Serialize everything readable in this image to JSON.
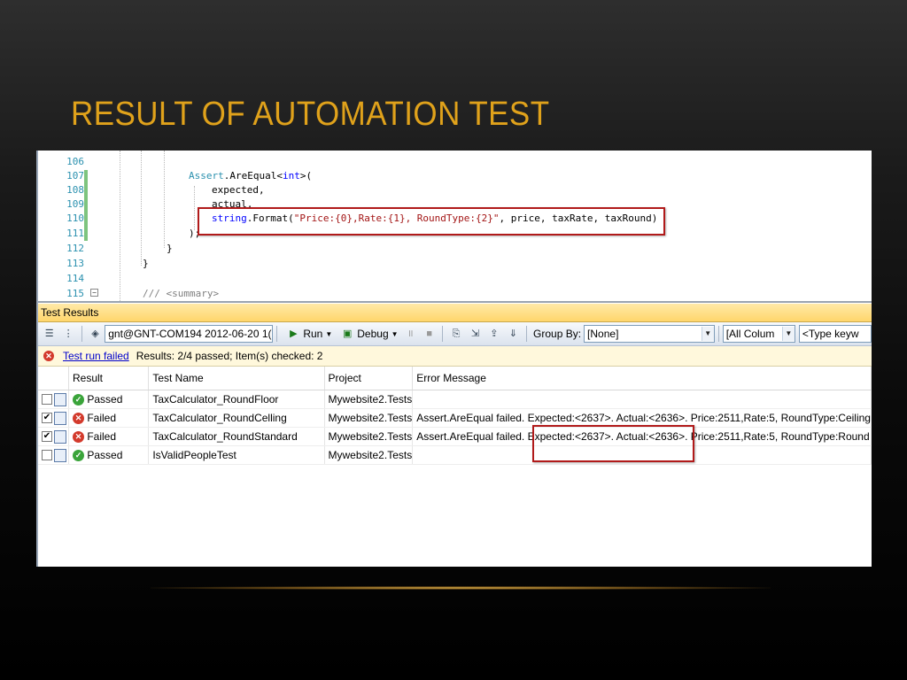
{
  "slide": {
    "title": "RESULT OF AUTOMATION TEST"
  },
  "editor": {
    "line_numbers": [
      "106",
      "107",
      "108",
      "109",
      "110",
      "111",
      "112",
      "113",
      "114",
      "115"
    ],
    "lines": {
      "l107_type": "Assert",
      "l107_rest": ".AreEqual<",
      "l107_kw": "int",
      "l107_end": ">(",
      "l108": "expected,",
      "l109": "actual,",
      "l110_kw": "string",
      "l110_mid": ".Format(",
      "l110_str": "\"Price:{0},Rate:{1}, RoundType:{2}\"",
      "l110_end": ", price, taxRate, taxRound)",
      "l111": ");",
      "l112": "}",
      "l113": "}",
      "l115": "/// <summary>"
    }
  },
  "panel": {
    "title": "Test Results",
    "toolbar": {
      "run_combo": "gnt@GNT-COM194 2012-06-20 1(",
      "run_label": "Run",
      "debug_label": "Debug",
      "group_by_label": "Group By:",
      "group_by_value": "[None]",
      "columns_value": "[All Colum",
      "keyword_placeholder": "<Type keyw"
    },
    "status": {
      "link": "Test run failed",
      "summary": "Results: 2/4 passed;  Item(s) checked: 2"
    },
    "columns": [
      "Result",
      "Test Name",
      "Project",
      "Error Message"
    ],
    "rows": [
      {
        "checked": false,
        "status": "pass",
        "result": "Passed",
        "name": "TaxCalculator_RoundFloor",
        "project": "Mywebsite2.Tests",
        "error": ""
      },
      {
        "checked": true,
        "status": "fail",
        "result": "Failed",
        "name": "TaxCalculator_RoundCelling",
        "project": "Mywebsite2.Tests",
        "error": "Assert.AreEqual failed. Expected:<2637>. Actual:<2636>. Price:2511,Rate:5, RoundType:Ceiling"
      },
      {
        "checked": true,
        "status": "fail",
        "result": "Failed",
        "name": "TaxCalculator_RoundStandard",
        "project": "Mywebsite2.Tests",
        "error": "Assert.AreEqual failed. Expected:<2637>. Actual:<2636>. Price:2511,Rate:5, RoundType:Round"
      },
      {
        "checked": false,
        "status": "pass",
        "result": "Passed",
        "name": "IsValidPeopleTest",
        "project": "Mywebsite2.Tests",
        "error": ""
      }
    ]
  },
  "colors": {
    "title": "#e0a21b",
    "highlight_box": "#b11a1a",
    "pass": "#3aa43a",
    "fail": "#d33a2c"
  },
  "icons": {
    "pass": "check-circle-icon",
    "fail": "x-circle-icon",
    "status_error": "error-circle-icon"
  }
}
